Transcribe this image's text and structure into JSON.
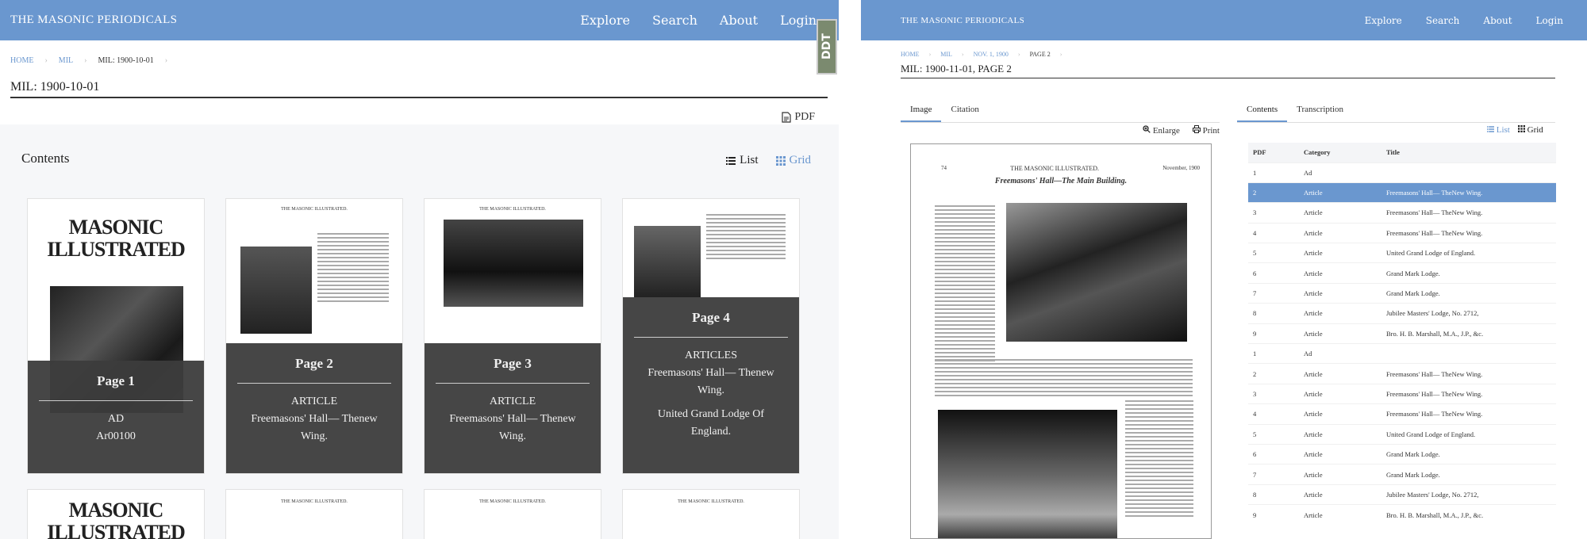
{
  "left": {
    "brand": "THE MASONIC PERIODICALS",
    "nav": [
      "Explore",
      "Search",
      "About",
      "Login"
    ],
    "breadcrumb": [
      "HOME",
      "MIL",
      "MIL: 1900-10-01"
    ],
    "title": "MIL: 1900-10-01",
    "pdf_label": "PDF",
    "contents_heading": "Contents",
    "view_list": "List",
    "view_grid": "Grid",
    "cards": [
      {
        "page": "Page 1",
        "category": "AD",
        "desc": "Ar00100"
      },
      {
        "page": "Page 2",
        "category": "ARTICLE",
        "desc": "Freemasons' Hall— Thenew Wing."
      },
      {
        "page": "Page 3",
        "category": "ARTICLE",
        "desc": "Freemasons' Hall— Thenew Wing."
      },
      {
        "page": "Page 4",
        "category": "ARTICLES",
        "desc": "Freemasons' Hall— Thenew Wing.",
        "desc2": "United Grand Lodge Of England."
      }
    ],
    "masthead": "MASONIC ILLUSTRATED",
    "mini_header": "THE MASONIC ILLUSTRATED.",
    "ddt_badge": "DDT"
  },
  "right": {
    "brand": "THE MASONIC PERIODICALS",
    "nav": [
      "Explore",
      "Search",
      "About",
      "Login"
    ],
    "breadcrumb": [
      "HOME",
      "MIL",
      "NOV. 1, 1900",
      "PAGE 2"
    ],
    "title": "MIL: 1900-11-01, PAGE 2",
    "tabs_left": [
      "Image",
      "Citation"
    ],
    "tabs_right": [
      "Contents",
      "Transcription"
    ],
    "enlarge": "Enlarge",
    "print": "Print",
    "view_list": "List",
    "view_grid": "Grid",
    "scan_header_left": "74",
    "scan_header_title": "THE MASONIC ILLUSTRATED.",
    "scan_header_right": "November, 1900",
    "scan_subtitle": "Freemasons' Hall—The Main Building.",
    "columns": [
      "PDF",
      "Category",
      "Title"
    ],
    "rows": [
      [
        "1",
        "Ad",
        ""
      ],
      [
        "2",
        "Article",
        "Freemasons' Hall— TheNew Wing."
      ],
      [
        "3",
        "Article",
        "Freemasons' Hall— TheNew Wing."
      ],
      [
        "4",
        "Article",
        "Freemasons' Hall— TheNew Wing."
      ],
      [
        "5",
        "Article",
        "United Grand Lodge of England."
      ],
      [
        "6",
        "Article",
        "Grand Mark Lodge."
      ],
      [
        "7",
        "Article",
        "Grand Mark Lodge."
      ],
      [
        "8",
        "Article",
        "Jubilee Masters' Lodge, No. 2712,"
      ],
      [
        "9",
        "Article",
        "Bro. H. B. Marshall, M.A., J.P., &c."
      ],
      [
        "1",
        "Ad",
        ""
      ],
      [
        "2",
        "Article",
        "Freemasons' Hall— TheNew Wing."
      ],
      [
        "3",
        "Article",
        "Freemasons' Hall— TheNew Wing."
      ],
      [
        "4",
        "Article",
        "Freemasons' Hall— TheNew Wing."
      ],
      [
        "5",
        "Article",
        "United Grand Lodge of England."
      ],
      [
        "6",
        "Article",
        "Grand Mark Lodge."
      ],
      [
        "7",
        "Article",
        "Grand Mark Lodge."
      ],
      [
        "8",
        "Article",
        "Jubilee Masters' Lodge, No. 2712,"
      ],
      [
        "9",
        "Article",
        "Bro. H. B. Marshall, M.A., J.P., &c."
      ]
    ],
    "selected_row": 1
  },
  "colors": {
    "accent": "#6a97cf",
    "overlay": "#3c3c3c",
    "selected": "#6a97cf"
  }
}
